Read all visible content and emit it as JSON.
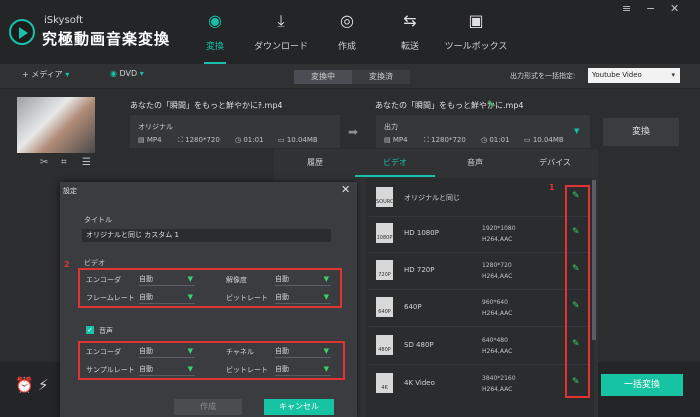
{
  "app": {
    "brand_small": "iSkysoft",
    "brand_name": "究極動画音楽変換"
  },
  "nav": [
    {
      "label": "変換",
      "icon": "convert-icon"
    },
    {
      "label": "ダウンロード",
      "icon": "download-icon"
    },
    {
      "label": "作成",
      "icon": "burn-disc-icon"
    },
    {
      "label": "転送",
      "icon": "transfer-icon"
    },
    {
      "label": "ツールボックス",
      "icon": "toolbox-icon"
    }
  ],
  "toolbar": {
    "add_media": "+ メディア",
    "dvd": "DVD",
    "tab_converting": "変換中",
    "tab_converted": "変換済",
    "output_format_label": "出力形式を一括指定:",
    "output_format_value": "Youtube Video"
  },
  "file": {
    "source_name": "あなたの「瞬間」をもっと鮮やかにﾁ.mp4",
    "target_name": "あなたの「瞬間」をもっと鮮やかに.mp4",
    "original_label": "オリジナル",
    "output_label": "出力",
    "original": {
      "format": "MP4",
      "resolution": "1280*720",
      "duration": "01:01",
      "size": "10.04MB"
    },
    "output": {
      "format": "MP4",
      "resolution": "1280*720",
      "duration": "01:01",
      "size": "10.04MB"
    },
    "convert_button": "変換"
  },
  "dialog": {
    "title": "設定",
    "title_label": "タイトル",
    "title_value": "オリジナルと同じ カスタム 1",
    "video_section": "ビデオ",
    "audio_section": "音声",
    "video": {
      "encoder_label": "エンコーダ",
      "encoder_value": "自動",
      "resolution_label": "解像度",
      "resolution_value": "自動",
      "framerate_label": "フレームレート",
      "framerate_value": "自動",
      "bitrate_label": "ビットレート",
      "bitrate_value": "自動"
    },
    "audio": {
      "encoder_label": "エンコーダ",
      "encoder_value": "自動",
      "channel_label": "チャネル",
      "channel_value": "自動",
      "samplerate_label": "サンプルレート",
      "samplerate_value": "自動",
      "bitrate_label": "ビットレート",
      "bitrate_value": "自動"
    },
    "create_button": "作成",
    "cancel_button": "キャンセル",
    "annotation_1": "1",
    "annotation_2": "2"
  },
  "panel": {
    "tabs": [
      "履歴",
      "ビデオ",
      "音声",
      "デバイス"
    ],
    "active_tab": "ビデオ",
    "items": [
      {
        "icon_text": "SOURCE",
        "name": "オリジナルと同じ",
        "res": "",
        "codec": ""
      },
      {
        "icon_text": "1080P",
        "name": "HD 1080P",
        "res": "1920*1080",
        "codec": "H264,AAC"
      },
      {
        "icon_text": "720P",
        "name": "HD 720P",
        "res": "1280*720",
        "codec": "H264,AAC"
      },
      {
        "icon_text": "640P",
        "name": "640P",
        "res": "960*640",
        "codec": "H264,AAC"
      },
      {
        "icon_text": "480P",
        "name": "SD 480P",
        "res": "640*480",
        "codec": "H264,AAC"
      },
      {
        "icon_text": "4K",
        "name": "4K Video",
        "res": "3840*2160",
        "codec": "H264,AAC"
      }
    ]
  },
  "bottom": {
    "bulk_convert": "一括変換"
  },
  "colors": {
    "accent": "#17c0a8",
    "annotation": "#e23333",
    "edit_green": "#3ad26e"
  }
}
